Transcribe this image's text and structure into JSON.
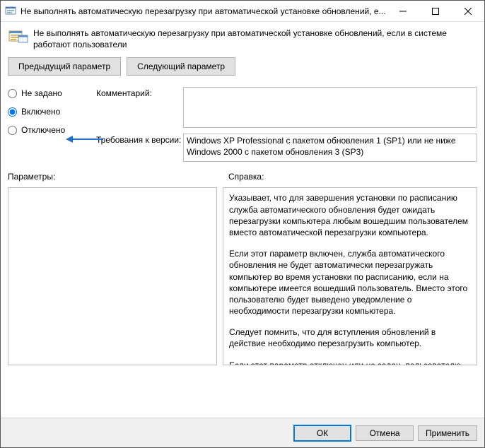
{
  "window": {
    "title": "Не выполнять автоматическую перезагрузку при автоматической установке обновлений, е..."
  },
  "header": {
    "text": "Не выполнять автоматическую перезагрузку при автоматической установке обновлений, если в системе работают пользователи"
  },
  "nav": {
    "prev": "Предыдущий параметр",
    "next": "Следующий параметр"
  },
  "radios": {
    "not_configured": "Не задано",
    "enabled": "Включено",
    "disabled": "Отключено",
    "selected": "enabled"
  },
  "labels": {
    "comment": "Комментарий:",
    "requirements": "Требования к версии:",
    "parameters": "Параметры:",
    "help": "Справка:"
  },
  "comment_value": "",
  "requirements_value": "Windows XP Professional с пакетом обновления 1 (SP1) или не ниже\nWindows 2000 с пакетом обновления 3 (SP3)",
  "help": {
    "p1": "Указывает, что для завершения установки по расписанию служба автоматического обновления будет ожидать перезагрузки компьютера любым вошедшим пользователем вместо автоматической перезагрузки компьютера.",
    "p2": "Если этот параметр включен, служба автоматического обновления не будет автоматически перезагружать компьютер во время установки по расписанию, если на компьютере имеется вошедший пользователь. Вместо этого пользователю будет выведено уведомление о необходимости перезагрузки компьютера.",
    "p3": "Следует помнить, что для вступления обновлений в действие необходимо перезагрузить компьютер.",
    "p4": "Если этот параметр отключен или не задан, пользователю"
  },
  "footer": {
    "ok": "ОК",
    "cancel": "Отмена",
    "apply": "Применить"
  }
}
